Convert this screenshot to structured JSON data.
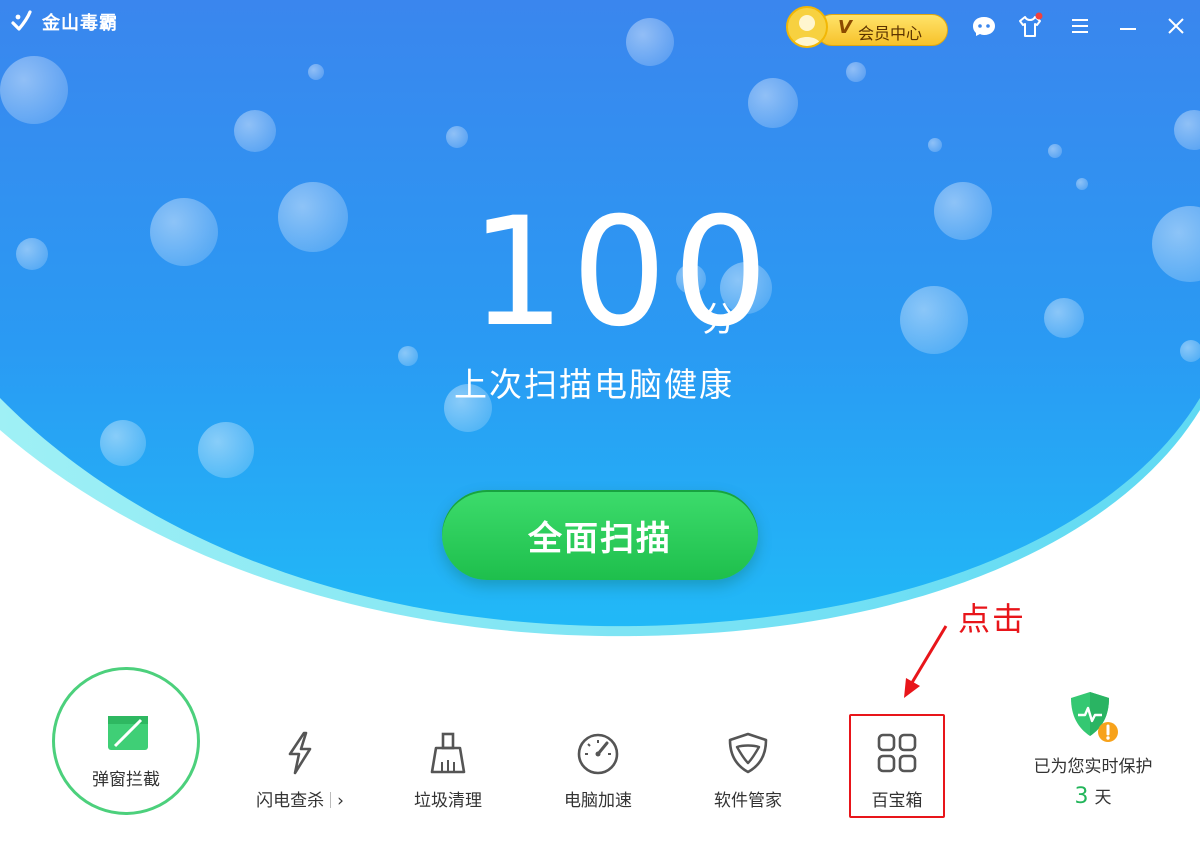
{
  "window": {
    "app_name": "金山毒霸",
    "vip_mark": "V",
    "vip_label": "会员中心",
    "icons": [
      "chat-bubble-icon",
      "tshirt-icon",
      "menu-icon",
      "minimize-icon",
      "close-icon"
    ]
  },
  "hero": {
    "score": "100",
    "score_unit": "分",
    "status_text": "上次扫描电脑健康",
    "scan_button": "全面扫描"
  },
  "annotation": {
    "text": "点击",
    "color": "#e8151a"
  },
  "tools": {
    "popup_block": "弹窗拦截",
    "flash_kill": "闪电查杀",
    "flash_kill_arrow": "›",
    "junk_clean": "垃圾清理",
    "pc_speedup": "电脑加速",
    "software_manager": "软件管家",
    "treasure_box": "百宝箱"
  },
  "protection": {
    "text": "已为您实时保护",
    "days": "3",
    "days_unit": "天"
  },
  "colors": {
    "accent_blue": "#2f8ff0",
    "scan_green": "#2dce5c",
    "protect_green": "#22b55a"
  }
}
